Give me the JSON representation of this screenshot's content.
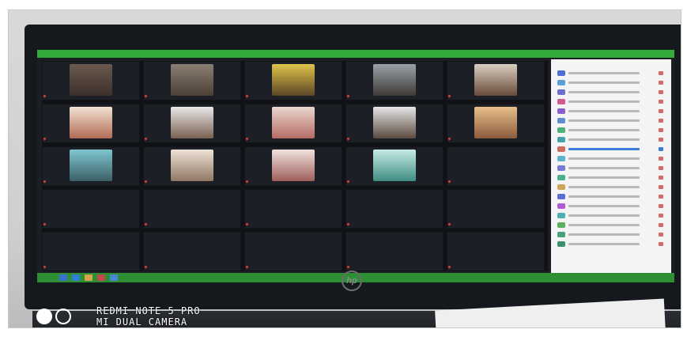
{
  "watermark": {
    "line1": "REDMI NOTE 5 PRO",
    "line2": "MI DUAL CAMERA"
  },
  "brand_logo": "hp",
  "colors": {
    "zoom_green": "#33aa3a",
    "taskbar_green": "#2d8f34",
    "meeting_bg": "#1b1e23",
    "panel_bg": "#f4f4f4",
    "mute_red": "#d13a3a"
  }
}
